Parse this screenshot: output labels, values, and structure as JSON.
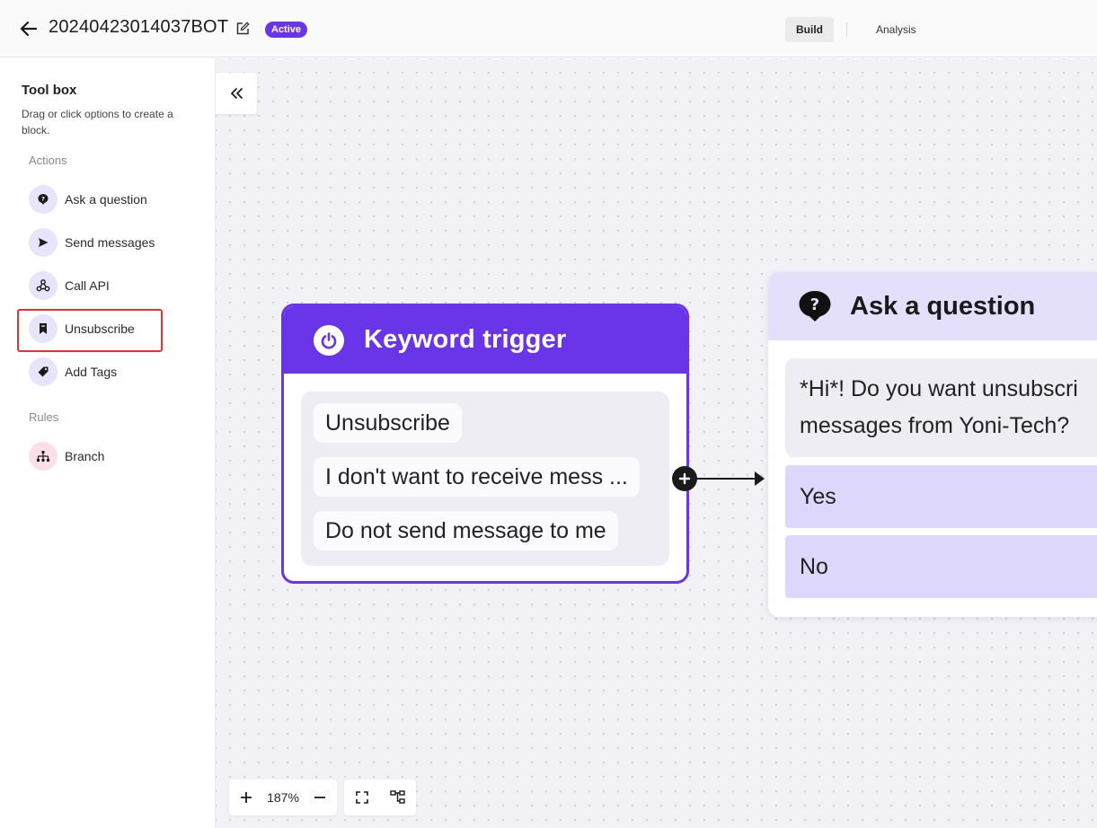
{
  "header": {
    "bot_name": "20240423014037BOT",
    "status": "Active",
    "tabs": [
      {
        "label": "Build",
        "active": true
      },
      {
        "label": "Analysis",
        "active": false
      }
    ]
  },
  "sidebar": {
    "title": "Tool box",
    "description": "Drag or click options to create a block.",
    "sections": [
      {
        "title": "Actions",
        "items": [
          {
            "label": "Ask a question",
            "icon": "question-bubble-icon"
          },
          {
            "label": "Send messages",
            "icon": "send-icon"
          },
          {
            "label": "Call API",
            "icon": "webhook-icon"
          },
          {
            "label": "Unsubscribe",
            "icon": "bookmark-icon",
            "highlighted": true
          },
          {
            "label": "Add Tags",
            "icon": "tag-icon"
          }
        ]
      },
      {
        "title": "Rules",
        "items": [
          {
            "label": "Branch",
            "icon": "branch-icon"
          }
        ]
      }
    ]
  },
  "canvas": {
    "trigger_node": {
      "title": "Keyword trigger",
      "keywords": [
        "Unsubscribe",
        "I don't want to receive mess ...",
        "Do not send message to me"
      ]
    },
    "question_node": {
      "title": "Ask a question",
      "question_lines": [
        "*Hi*! Do you want unsubscri",
        "messages from Yoni-Tech?"
      ],
      "answers": [
        "Yes",
        "No"
      ]
    },
    "zoom": "187%"
  },
  "colors": {
    "accent": "#6a35e8",
    "question_header": "#e4dffb",
    "answer_bg": "#dcd7fb",
    "highlight": "#e5312f"
  }
}
